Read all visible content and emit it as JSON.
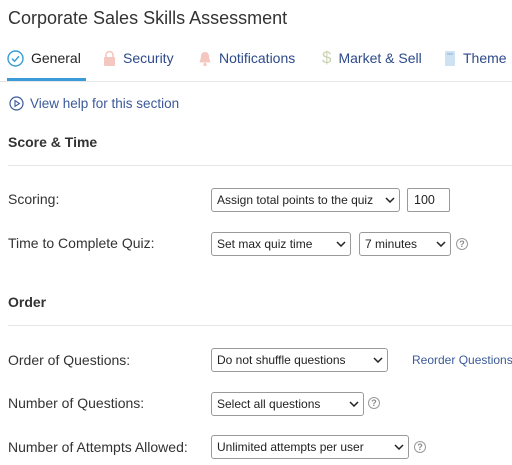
{
  "page": {
    "title": "Corporate Sales Skills Assessment"
  },
  "tabs": [
    {
      "label": "General",
      "icon": "check-circle-icon",
      "active": true
    },
    {
      "label": "Security",
      "icon": "lock-icon",
      "active": false
    },
    {
      "label": "Notifications",
      "icon": "bell-icon",
      "active": false
    },
    {
      "label": "Market & Sell",
      "icon": "dollar-icon",
      "active": false
    },
    {
      "label": "Theme",
      "icon": "theme-icon",
      "active": false
    }
  ],
  "help": {
    "label": "View help for this section",
    "icon": "play-circle-icon"
  },
  "score_time": {
    "heading": "Score & Time",
    "scoring": {
      "label": "Scoring:",
      "select": "Assign total points to the quiz",
      "points": "100"
    },
    "time": {
      "label": "Time to Complete Quiz:",
      "mode": "Set max quiz time",
      "duration": "7 minutes",
      "help": "?"
    }
  },
  "order": {
    "heading": "Order",
    "order_questions": {
      "label": "Order of Questions:",
      "select": "Do not shuffle questions",
      "link": "Reorder Questions"
    },
    "number_questions": {
      "label": "Number of Questions:",
      "select": "Select all questions",
      "help": "?"
    },
    "attempts": {
      "label": "Number of Attempts Allowed:",
      "select": "Unlimited attempts per user",
      "help": "?"
    }
  },
  "colors": {
    "accent": "#3a9bd8",
    "link": "#3b5a9a",
    "tab_text": "#2d4a8a",
    "muted_icon": "#f3c0c0"
  }
}
